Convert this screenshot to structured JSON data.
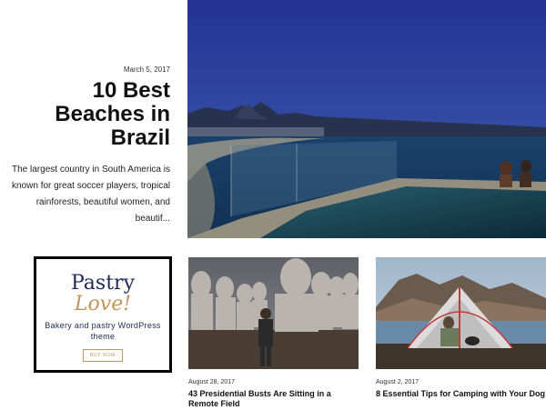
{
  "featured": {
    "date": "March 5, 2017",
    "title": "10 Best Beaches in Brazil",
    "excerpt": "The largest country in South America is known for great soccer players, tropical rainforests, beautiful women, and beautif..."
  },
  "ad": {
    "title_line1": "Pastry",
    "title_line2": "Love!",
    "subtitle": "Bakery and pastry WordPress theme",
    "button_label": "BUY NOW"
  },
  "posts": [
    {
      "date": "August 28, 2017",
      "title": "43 Presidential Busts Are Sitting in a Remote Field"
    },
    {
      "date": "August 2, 2017",
      "title": "8 Essential Tips for Camping with Your Dog"
    }
  ],
  "colors": {
    "ad_navy": "#1e2a55",
    "ad_gold": "#c0965a",
    "text": "#111111"
  }
}
